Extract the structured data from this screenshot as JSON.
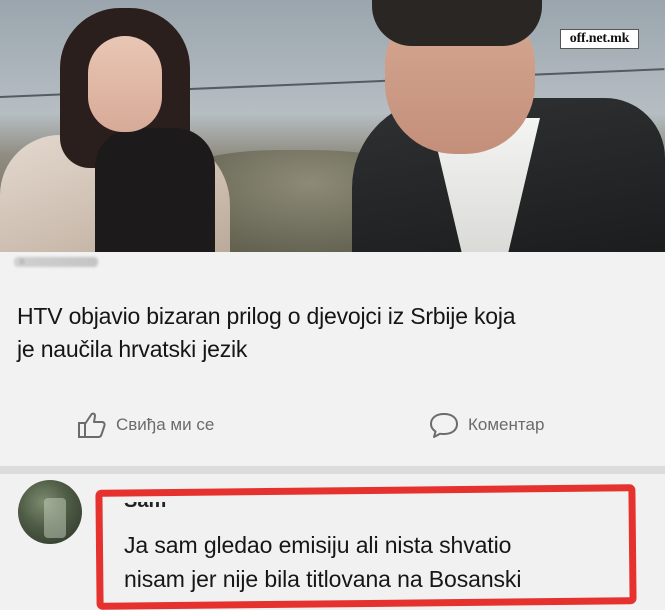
{
  "watermark": "off.net.mk",
  "post": {
    "meta": "b",
    "headline_line1": "HTV objavio bizaran prilog o djevojci iz Srbije koja",
    "headline_line2": "je naučila hrvatski jezik"
  },
  "actions": {
    "like_label": "Свиђа ми се",
    "comment_label": "Коментар"
  },
  "comment": {
    "author": "Sam",
    "line1": "Ja sam gledao emisiju ali nista shvatio",
    "line2": "nisam jer nije bila titlovana na Bosanski"
  },
  "colors": {
    "highlight": "#e5322f",
    "action_gray": "#6b6b6b"
  },
  "icons": [
    "thumbs-up-icon",
    "speech-bubble-icon"
  ]
}
